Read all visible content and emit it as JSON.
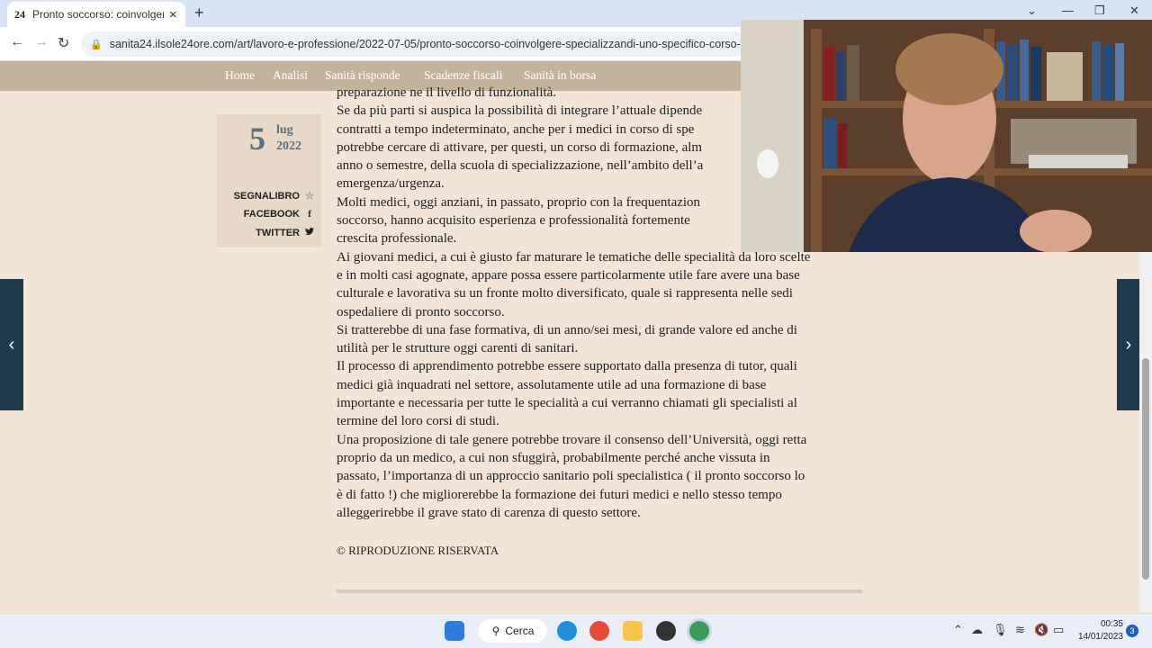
{
  "browser": {
    "tab_title": "Pronto soccorso: coinvolgere gli",
    "tab_favicon": "24",
    "new_tab": "+",
    "tab_close": "×",
    "url": "sanita24.ilsole24ore.com/art/lavoro-e-professione/2022-07-05/pronto-soccorso-coinvolgere-specializzandi-uno-specifico-corso-formazio"
  },
  "site_nav": [
    "Home",
    "Analisi",
    "Sanità risponde",
    "Scadenze fiscali",
    "Sanità in borsa"
  ],
  "date": {
    "day": "5",
    "month": "lug",
    "year": "2022"
  },
  "share": {
    "segnalibro": "SEGNALIBRO",
    "facebook": "FACEBOOK",
    "twitter": "TWITTER"
  },
  "article": {
    "lines": [
      "preparazione ne il livello di funzionalità.",
      "Se da più parti si auspica la possibilità di integrare l’attuale dipende",
      "contratti a tempo indeterminato, anche per i medici in corso di spe",
      "potrebbe cercare di attivare, per questi, un corso di formazione, alm",
      "anno o semestre, della scuola di specializzazione, nell’ambito dell’a",
      "emergenza/urgenza.",
      "Molti medici, oggi anziani, in passato, proprio con la frequentazion",
      "soccorso, hanno acquisito esperienza e professionalità fortemente",
      "crescita professionale.",
      "Ai giovani medici, a cui è giusto far maturare le tematiche delle specialità da loro scelte",
      "e in molti casi agognate, appare possa essere particolarmente utile fare avere una base",
      "culturale e lavorativa su un fronte molto diversificato, quale si rappresenta nelle sedi",
      "ospedaliere di pronto soccorso.",
      "Si tratterebbe di una fase formativa, di un anno/sei mesi, di grande valore ed anche di",
      "utilità per le strutture oggi carenti di sanitari.",
      "Il processo di apprendimento potrebbe essere supportato dalla presenza di tutor, quali",
      "medici già inquadrati nel settore, assolutamente utile ad una formazione di base",
      "importante e necessaria per tutte le specialità a cui verranno chiamati gli specialisti al",
      "termine del loro corsi di studi.",
      "Una proposizione di tale genere potrebbe trovare il consenso dell’Università, oggi retta",
      "proprio da un medico, a cui non sfuggirà, probabilmente perché anche vissuta in",
      "passato, l’importanza di un approccio sanitario poli specialistica ( il pronto soccorso lo",
      "è di fatto !) che migliorerebbe la formazione dei futuri medici e nello stesso tempo",
      "alleggerirebbe il grave stato di carenza di questo settore."
    ],
    "copyright": "© RIPRODUZIONE RISERVATA"
  },
  "taskbar": {
    "search_label": "Cerca",
    "time": "00:35",
    "date": "14/01/2023",
    "notification_count": "3"
  },
  "colors": {
    "page_background": "#f2e4d6",
    "nav_background": "#c5b29d",
    "date_text": "#5a7080",
    "side_arrow": "#1f3a4a"
  }
}
